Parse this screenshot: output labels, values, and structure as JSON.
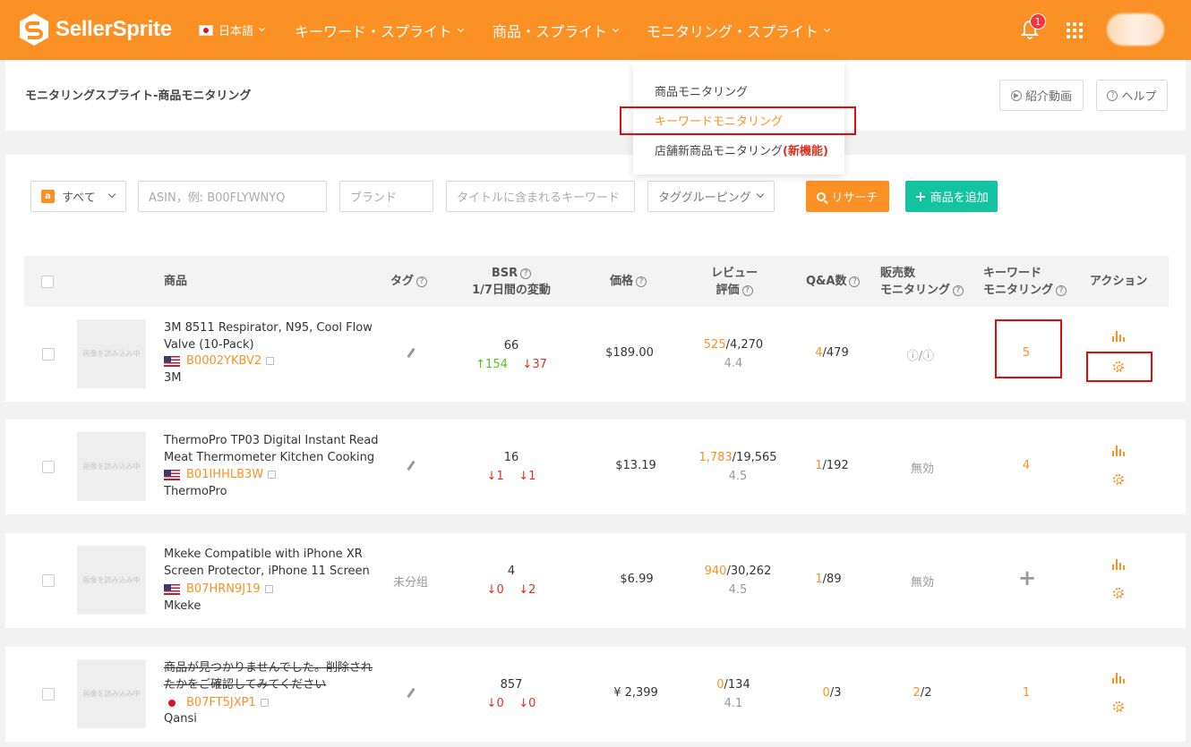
{
  "nav": {
    "logo": "SellerSprite",
    "language": "日本語",
    "items": [
      "キーワード・スプライト",
      "商品・スプライト",
      "モニタリング・スプライト"
    ],
    "notification_count": "1"
  },
  "dropdown": {
    "items": [
      {
        "label": "商品モニタリング",
        "badge": ""
      },
      {
        "label": "キーワードモニタリング",
        "badge": ""
      },
      {
        "label": "店舗新商品モニタリング",
        "badge": "(新機能)"
      }
    ]
  },
  "header": {
    "title": "モニタリングスプライト-商品モニタリング",
    "video_button": "紹介動画",
    "help_button": "ヘルプ"
  },
  "filters": {
    "marketplace": "すべて",
    "asin_placeholder": "ASIN，例: B00FLYWNYQ",
    "brand_placeholder": "ブランド",
    "keyword_placeholder": "タイトルに含まれるキーワード",
    "tag_group": "タググルーピング",
    "search_button": "リサーチ",
    "add_button": "商品を追加"
  },
  "table": {
    "headers": {
      "product": "商品",
      "tag": "タグ",
      "bsr_line1": "BSR",
      "bsr_line2": "1/7日間の変動",
      "price": "価格",
      "review_line1": "レビュー",
      "review_line2": "評価",
      "qa": "Q&A数",
      "sales_line1": "販売数",
      "sales_line2": "モニタリング",
      "kw_line1": "キーワード",
      "kw_line2": "モニタリング",
      "action": "アクション"
    },
    "thumb_placeholder": "画像を読み込み中",
    "rows": [
      {
        "title_line1": "3M 8511 Respirator, N95, Cool Flow",
        "title_line2": "Valve (10-Pack)",
        "asin": "B0002YKBV2",
        "country": "us",
        "brand": "3M",
        "tag": "",
        "bsr": "66",
        "bsr_1d": "154",
        "bsr_1d_dir": "up",
        "bsr_7d": "37",
        "bsr_7d_dir": "down",
        "price": "$189.00",
        "reviews_new": "525",
        "reviews_total": "/4,270",
        "rating": "4.4",
        "qa_new": "4",
        "qa_total": "/479",
        "sales": "ⓘ/ⓘ",
        "keyword_monitoring": "5"
      },
      {
        "title_line1": "ThermoPro TP03 Digital Instant Read",
        "title_line2": "Meat Thermometer Kitchen Cooking",
        "asin": "B01IHHLB3W",
        "country": "us",
        "brand": "ThermoPro",
        "tag": "",
        "bsr": "16",
        "bsr_1d": "1",
        "bsr_1d_dir": "down",
        "bsr_7d": "1",
        "bsr_7d_dir": "down",
        "price": "$13.19",
        "reviews_new": "1,783",
        "reviews_total": "/19,565",
        "rating": "4.5",
        "qa_new": "1",
        "qa_total": "/192",
        "sales": "無効",
        "keyword_monitoring": "4"
      },
      {
        "title_line1": "Mkeke Compatible with iPhone XR",
        "title_line2": "Screen Protector, iPhone 11 Screen",
        "asin": "B07HRN9J19",
        "country": "us",
        "brand": "Mkeke",
        "tag": "未分组",
        "bsr": "4",
        "bsr_1d": "0",
        "bsr_1d_dir": "down",
        "bsr_7d": "2",
        "bsr_7d_dir": "down",
        "price": "$6.99",
        "reviews_new": "940",
        "reviews_total": "/30,262",
        "rating": "4.5",
        "qa_new": "1",
        "qa_total": "/89",
        "sales": "無効",
        "keyword_monitoring": "+"
      },
      {
        "title_line1": "商品が見つかりませんでした。削除され",
        "title_line2": "たかをご確認してみてください",
        "asin": "B07FT5JXP1",
        "country": "jp",
        "brand": "Qansi",
        "tag": "",
        "bsr": "857",
        "bsr_1d": "0",
        "bsr_1d_dir": "down",
        "bsr_7d": "0",
        "bsr_7d_dir": "down",
        "price": "¥ 2,399",
        "reviews_new": "0",
        "reviews_total": "/134",
        "rating": "4.1",
        "qa_new": "0",
        "qa_total": "/3",
        "sales_new": "2",
        "sales": "/2",
        "keyword_monitoring": "1"
      }
    ]
  },
  "colors": {
    "brand_orange": "#fb9124",
    "accent_teal": "#13c4a0",
    "highlight_red": "#e30b0b",
    "up_green": "#52c41a",
    "down_red": "#e0301e"
  },
  "icons": [
    "logo-icon",
    "flag-jp-icon",
    "bell-icon",
    "apps-grid-icon",
    "avatar",
    "play-circle-icon",
    "help-circle-icon",
    "amazon-icon",
    "search-icon",
    "plus-icon",
    "pencil-icon",
    "flag-us-icon",
    "external-link-icon",
    "chart-bars-icon",
    "gear-icon"
  ]
}
